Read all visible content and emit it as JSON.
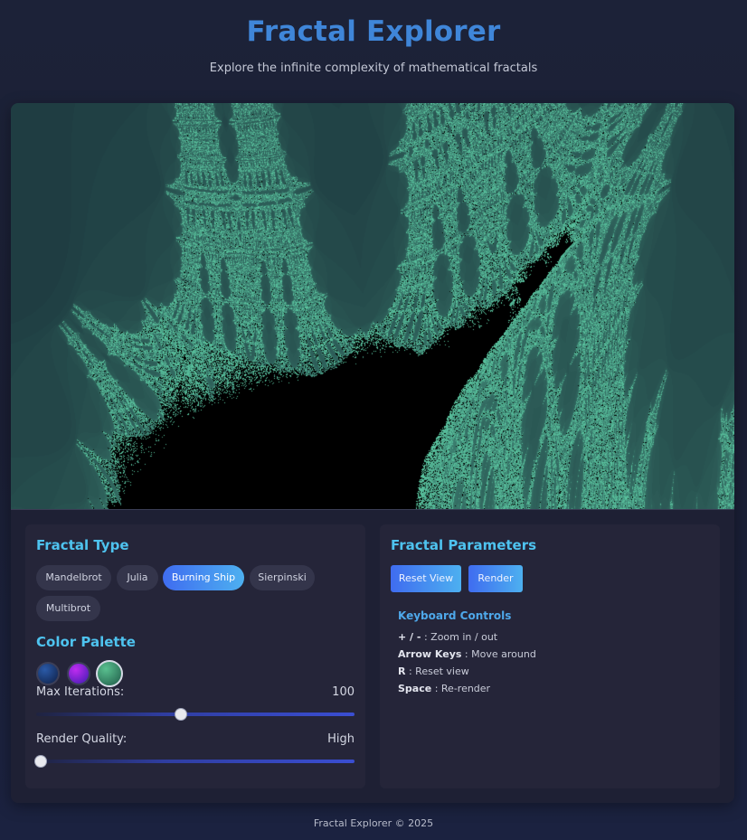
{
  "header": {
    "title": "Fractal Explorer",
    "subtitle": "Explore the infinite complexity of mathematical fractals"
  },
  "canvas": {
    "fractal": "Burning Ship",
    "colors": {
      "background": "#000000",
      "glow": "#5ec49a",
      "dim": "#1c5c52"
    }
  },
  "fractal_type": {
    "title": "Fractal Type",
    "options": [
      "Mandelbrot",
      "Julia",
      "Burning Ship",
      "Sierpinski",
      "Multibrot"
    ],
    "active": "Burning Ship"
  },
  "color_palette": {
    "title": "Color Palette",
    "swatches": [
      {
        "name": "ocean",
        "from": "#2a5aa8",
        "to": "#0f1f45"
      },
      {
        "name": "violet",
        "from": "#c02cf0",
        "to": "#3b1bb0"
      },
      {
        "name": "emerald",
        "from": "#59c08f",
        "to": "#1f5a48"
      }
    ],
    "selected": "emerald"
  },
  "iterations": {
    "label": "Max Iterations:",
    "value": "100",
    "fraction": 0.455
  },
  "quality": {
    "label": "Render Quality:",
    "value": "High",
    "fraction": 0.0
  },
  "parameters": {
    "title": "Fractal Parameters",
    "reset_label": "Reset View",
    "render_label": "Render"
  },
  "keyboard": {
    "title": "Keyboard Controls",
    "rows": [
      {
        "key": "+ / -",
        "desc": ": Zoom in / out"
      },
      {
        "key": "Arrow Keys",
        "desc": ": Move around"
      },
      {
        "key": "R",
        "desc": ": Reset view"
      },
      {
        "key": "Space",
        "desc": ": Re-render"
      }
    ]
  },
  "footer": {
    "text": "Fractal Explorer © 2025"
  }
}
